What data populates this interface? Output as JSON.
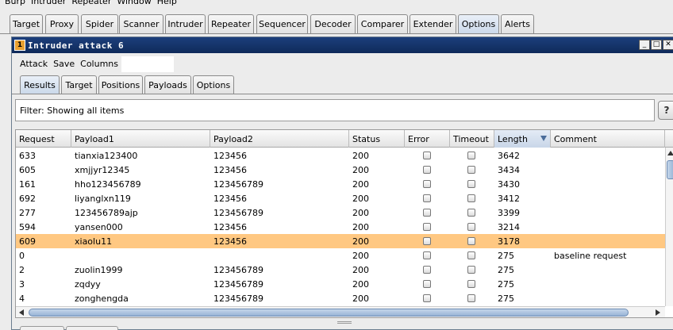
{
  "menubar": {
    "items": [
      "Burp",
      "Intruder",
      "Repeater",
      "Window",
      "Help"
    ]
  },
  "main_tabs": [
    "Target",
    "Proxy",
    "Spider",
    "Scanner",
    "Intruder",
    "Repeater",
    "Sequencer",
    "Decoder",
    "Comparer",
    "Extender",
    "Options",
    "Alerts"
  ],
  "main_tabs_active": "Options",
  "window": {
    "title": "Intruder attack 6",
    "icon_glyph": "1",
    "min_glyph": "_",
    "max_glyph": "□",
    "close_glyph": "✕"
  },
  "window_menu": [
    "Attack",
    "Save",
    "Columns"
  ],
  "inner_tabs": [
    "Results",
    "Target",
    "Positions",
    "Payloads",
    "Options"
  ],
  "inner_tabs_active": "Results",
  "filter": {
    "text": "Filter:  Showing all items"
  },
  "help_button": {
    "label": "?"
  },
  "table": {
    "headers": [
      "Request",
      "Payload1",
      "Payload2",
      "Status",
      "Error",
      "Timeout",
      "Length",
      "Comment"
    ],
    "sorted_column": "Length",
    "sort_direction": "descending",
    "rows": [
      {
        "request": "633",
        "payload1": "tianxia123400",
        "payload2": "123456",
        "status": "200",
        "error": false,
        "timeout": false,
        "length": "3642",
        "comment": ""
      },
      {
        "request": "605",
        "payload1": "xmjjyr12345",
        "payload2": "123456",
        "status": "200",
        "error": false,
        "timeout": false,
        "length": "3434",
        "comment": ""
      },
      {
        "request": "161",
        "payload1": "hho123456789",
        "payload2": "123456789",
        "status": "200",
        "error": false,
        "timeout": false,
        "length": "3430",
        "comment": ""
      },
      {
        "request": "692",
        "payload1": "liyanglxn119",
        "payload2": "123456",
        "status": "200",
        "error": false,
        "timeout": false,
        "length": "3412",
        "comment": ""
      },
      {
        "request": "277",
        "payload1": "123456789ajp",
        "payload2": "123456789",
        "status": "200",
        "error": false,
        "timeout": false,
        "length": "3399",
        "comment": ""
      },
      {
        "request": "594",
        "payload1": "yansen000",
        "payload2": "123456",
        "status": "200",
        "error": false,
        "timeout": false,
        "length": "3214",
        "comment": ""
      },
      {
        "request": "609",
        "payload1": "xiaolu11",
        "payload2": "123456",
        "status": "200",
        "error": false,
        "timeout": false,
        "length": "3178",
        "comment": "",
        "selected": true
      },
      {
        "request": "0",
        "payload1": "",
        "payload2": "",
        "status": "200",
        "error": false,
        "timeout": false,
        "length": "275",
        "comment": "baseline request"
      },
      {
        "request": "2",
        "payload1": "zuolin1999",
        "payload2": "123456789",
        "status": "200",
        "error": false,
        "timeout": false,
        "length": "275",
        "comment": ""
      },
      {
        "request": "3",
        "payload1": "zqdyy",
        "payload2": "123456789",
        "status": "200",
        "error": false,
        "timeout": false,
        "length": "275",
        "comment": ""
      },
      {
        "request": "4",
        "payload1": "zonghengda",
        "payload2": "123456789",
        "status": "200",
        "error": false,
        "timeout": false,
        "length": "275",
        "comment": ""
      }
    ]
  },
  "colors": {
    "selected_row": "#ffc882",
    "titlebar": "#0f2a5a",
    "active_tab": "#cbd9ea"
  }
}
